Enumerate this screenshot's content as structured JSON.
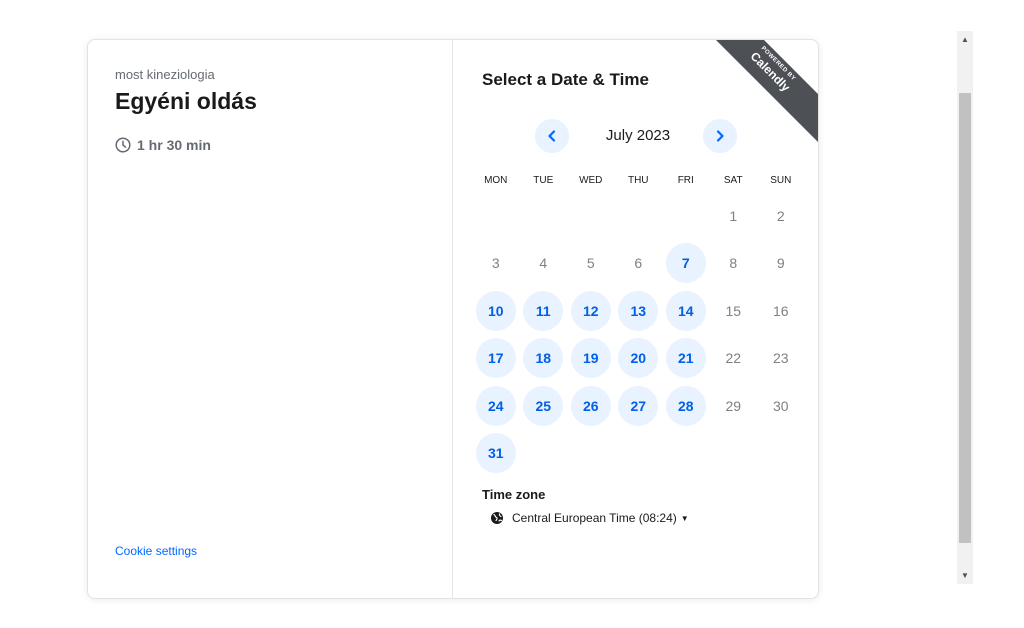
{
  "left": {
    "organizer": "most kineziologia",
    "event_title": "Egyéni oldás",
    "duration": "1 hr 30 min",
    "cookie_settings": "Cookie settings"
  },
  "right": {
    "heading": "Select a Date & Time",
    "badge": {
      "top": "POWERED BY",
      "brand": "Calendly"
    },
    "month": "July 2023",
    "weekdays": [
      "MON",
      "TUE",
      "WED",
      "THU",
      "FRI",
      "SAT",
      "SUN"
    ],
    "rows": [
      [
        null,
        null,
        null,
        null,
        null,
        {
          "d": "1",
          "a": false
        },
        {
          "d": "2",
          "a": false
        }
      ],
      [
        {
          "d": "3",
          "a": false
        },
        {
          "d": "4",
          "a": false
        },
        {
          "d": "5",
          "a": false
        },
        {
          "d": "6",
          "a": false
        },
        {
          "d": "7",
          "a": true
        },
        {
          "d": "8",
          "a": false
        },
        {
          "d": "9",
          "a": false
        }
      ],
      [
        {
          "d": "10",
          "a": true
        },
        {
          "d": "11",
          "a": true
        },
        {
          "d": "12",
          "a": true
        },
        {
          "d": "13",
          "a": true
        },
        {
          "d": "14",
          "a": true
        },
        {
          "d": "15",
          "a": false
        },
        {
          "d": "16",
          "a": false
        }
      ],
      [
        {
          "d": "17",
          "a": true
        },
        {
          "d": "18",
          "a": true
        },
        {
          "d": "19",
          "a": true
        },
        {
          "d": "20",
          "a": true
        },
        {
          "d": "21",
          "a": true
        },
        {
          "d": "22",
          "a": false
        },
        {
          "d": "23",
          "a": false
        }
      ],
      [
        {
          "d": "24",
          "a": true
        },
        {
          "d": "25",
          "a": true
        },
        {
          "d": "26",
          "a": true
        },
        {
          "d": "27",
          "a": true
        },
        {
          "d": "28",
          "a": true
        },
        {
          "d": "29",
          "a": false
        },
        {
          "d": "30",
          "a": false
        }
      ],
      [
        {
          "d": "31",
          "a": true
        },
        null,
        null,
        null,
        null,
        null,
        null
      ]
    ],
    "timezone_label": "Time zone",
    "timezone_value": "Central European Time (08:24)"
  },
  "colors": {
    "accent": "#0069ff",
    "available_bg": "#e9f2ff",
    "ribbon": "#4d5055"
  }
}
